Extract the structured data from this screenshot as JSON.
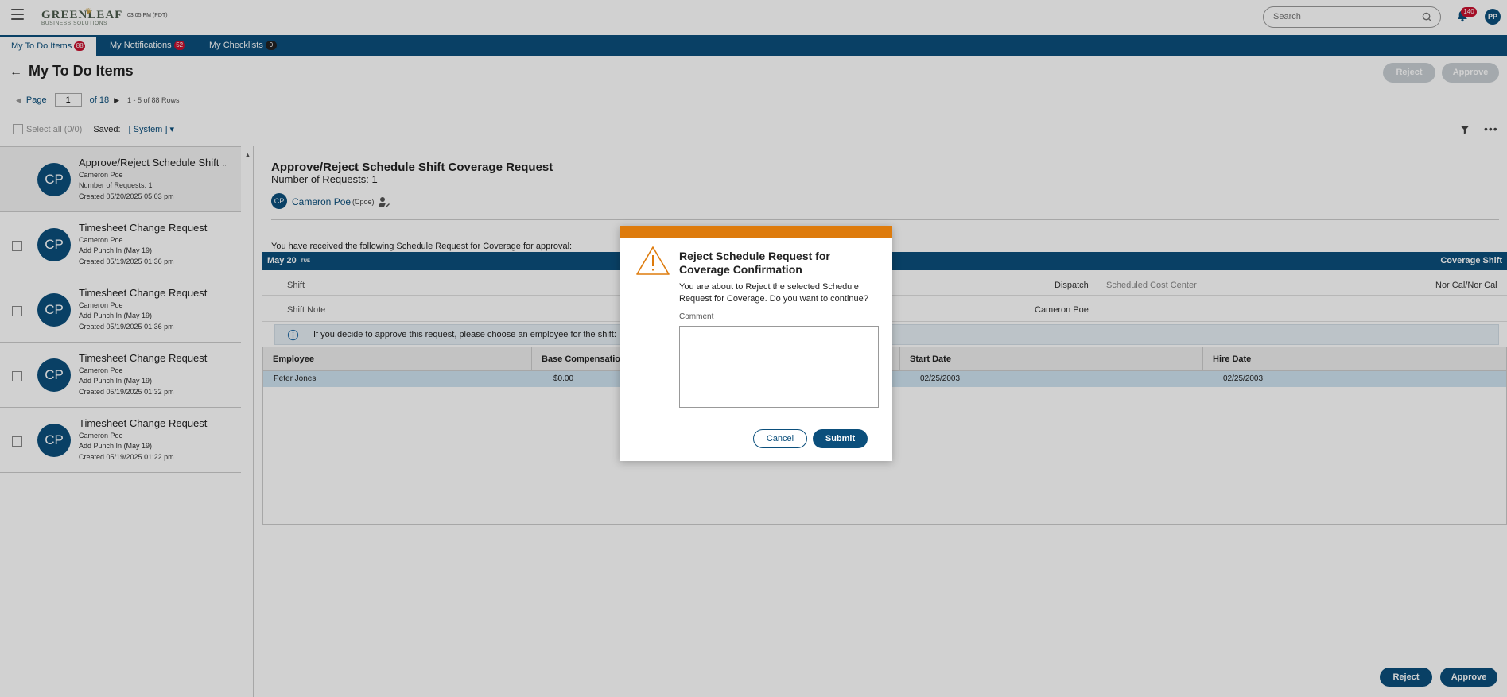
{
  "app": {
    "logo_text": "GREENLEAF",
    "logo_sub": "BUSINESS SOLUTIONS",
    "clock": "03:05 PM (PDT)",
    "search_placeholder": "Search",
    "notification_count": "140",
    "user_initials": "PP",
    "brand_color": "#0b4f7c",
    "alert_color": "#c8102e"
  },
  "tabs": [
    {
      "label": "My To Do Items",
      "badge": "88",
      "active": true
    },
    {
      "label": "My Notifications",
      "badge": "52",
      "active": false
    },
    {
      "label": "My Checklists",
      "badge": "0",
      "active": false
    }
  ],
  "header": {
    "title": "My To Do Items",
    "reject_label": "Reject",
    "approve_label": "Approve"
  },
  "pager": {
    "page_label": "Page",
    "current_page": "1",
    "of_label": "of 18",
    "rows_label": "1 - 5 of 88 Rows"
  },
  "filters": {
    "select_all": "Select all (0/0)",
    "saved_label": "Saved:",
    "saved_value": "[ System ]"
  },
  "items": [
    {
      "initials": "CP",
      "title": "Approve/Reject Schedule Shift ...",
      "lines": [
        "Cameron Poe",
        "Number of Requests: 1",
        "Created 05/20/2025 05:03 pm"
      ],
      "selected": true
    },
    {
      "initials": "CP",
      "title": "Timesheet Change Request",
      "lines": [
        "Cameron Poe",
        "Add Punch In (May 19)",
        "Created 05/19/2025 01:36 pm"
      ],
      "selected": false
    },
    {
      "initials": "CP",
      "title": "Timesheet Change Request",
      "lines": [
        "Cameron Poe",
        "Add Punch In (May 19)",
        "Created 05/19/2025 01:36 pm"
      ],
      "selected": false
    },
    {
      "initials": "CP",
      "title": "Timesheet Change Request",
      "lines": [
        "Cameron Poe",
        "Add Punch In (May 19)",
        "Created 05/19/2025 01:32 pm"
      ],
      "selected": false
    },
    {
      "initials": "CP",
      "title": "Timesheet Change Request",
      "lines": [
        "Cameron Poe",
        "Add Punch In (May 19)",
        "Created 05/19/2025 01:22 pm"
      ],
      "selected": false
    }
  ],
  "detail": {
    "title": "Approve/Reject Schedule Shift Coverage Request",
    "subtitle": "Number of Requests: 1",
    "requester_initials": "CP",
    "requester_name": "Cameron Poe",
    "requester_user": "(Cpoe)",
    "received_text": "You have received the following Schedule Request for Coverage for approval:",
    "day_date": "May 20",
    "day_dow": "TUE",
    "day_right": "Coverage Shift",
    "field_shift": "Shift",
    "field_dispatch": "Dispatch",
    "field_cost_center_label": "Scheduled Cost Center",
    "field_cost_center_value": "Nor Cal/Nor Cal",
    "field_shift_note": "Shift Note",
    "field_employee_value": "Cameron Poe",
    "info_text": "If you decide to approve this request, please choose an employee for the shift:",
    "grid_headers": [
      "Employee",
      "Base Compensation",
      "Start Date",
      "Hire Date"
    ],
    "grid_row": [
      "Peter Jones",
      "$0.00",
      "02/25/2003",
      "02/25/2003"
    ]
  },
  "footer": {
    "reject_label": "Reject",
    "approve_label": "Approve"
  },
  "modal": {
    "title": "Reject Schedule Request for Coverage Confirmation",
    "message": "You are about to Reject the selected Schedule Request for Coverage. Do you want to continue?",
    "comment_label": "Comment",
    "comment_value": "",
    "cancel_label": "Cancel",
    "submit_label": "Submit",
    "accent_color": "#de7b0c"
  }
}
